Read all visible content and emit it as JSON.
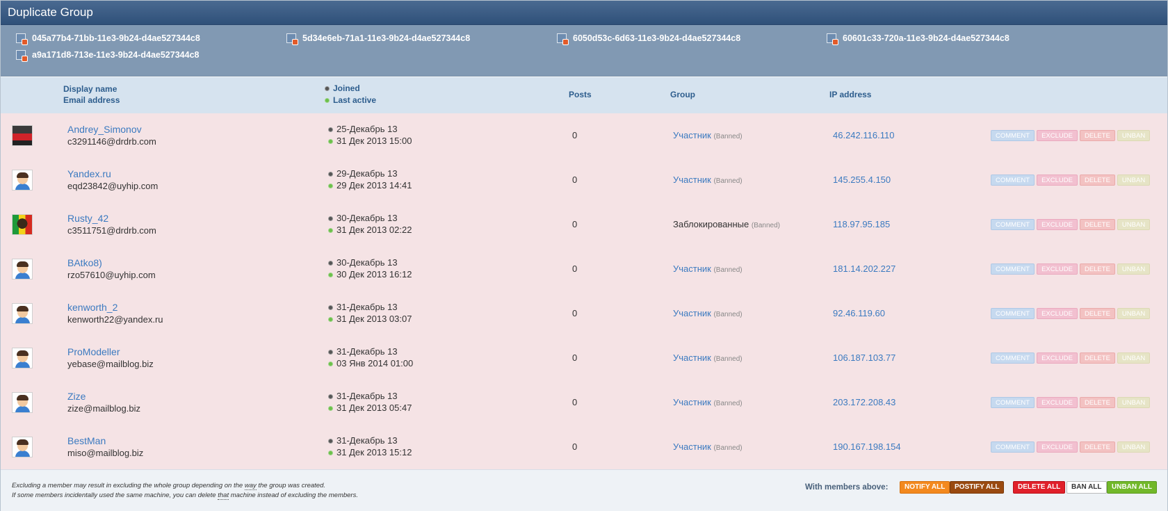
{
  "window": {
    "title": "Duplicate Group"
  },
  "machines": [
    "045a77b4-71bb-11e3-9b24-d4ae527344c8",
    "5d34e6eb-71a1-11e3-9b24-d4ae527344c8",
    "6050d53c-6d63-11e3-9b24-d4ae527344c8",
    "60601c33-720a-11e3-9b24-d4ae527344c8",
    "a9a171d8-713e-11e3-9b24-d4ae527344c8"
  ],
  "header": {
    "display_name": "Display name",
    "email": "Email address",
    "joined": "Joined",
    "last_active": "Last active",
    "posts": "Posts",
    "group": "Group",
    "ip": "IP address"
  },
  "banned_label": "(Banned)",
  "row_buttons": {
    "comment": "COMMENT",
    "exclude": "EXCLUDE",
    "delete": "DELETE",
    "unban": "UNBAN"
  },
  "members": [
    {
      "name": "Andrey_Simonov",
      "email": "c3291146@drdrb.com",
      "joined": "25-Декабрь 13",
      "last_active": "31 Дек 2013 15:00",
      "posts": "0",
      "group": "Участник",
      "ip": "46.242.116.110",
      "avatar": "car-avatar"
    },
    {
      "name": "Yandex.ru",
      "email": "eqd23842@uyhip.com",
      "joined": "29-Декабрь 13",
      "last_active": "29 Дек 2013 14:41",
      "posts": "0",
      "group": "Участник",
      "ip": "145.255.4.150",
      "avatar": "default-avatar"
    },
    {
      "name": "Rusty_42",
      "email": "c3511751@drdrb.com",
      "joined": "30-Декабрь 13",
      "last_active": "31 Дек 2013 02:22",
      "posts": "0",
      "group": "Заблокированные",
      "ip": "118.97.95.185",
      "avatar": "reggae-avatar"
    },
    {
      "name": "BAtko8)",
      "email": "rzo57610@uyhip.com",
      "joined": "30-Декабрь 13",
      "last_active": "30 Дек 2013 16:12",
      "posts": "0",
      "group": "Участник",
      "ip": "181.14.202.227",
      "avatar": "default-avatar"
    },
    {
      "name": "kenworth_2",
      "email": "kenworth22@yandex.ru",
      "joined": "31-Декабрь 13",
      "last_active": "31 Дек 2013 03:07",
      "posts": "0",
      "group": "Участник",
      "ip": "92.46.119.60",
      "avatar": "default-avatar"
    },
    {
      "name": "ProModeller",
      "email": "yebase@mailblog.biz",
      "joined": "31-Декабрь 13",
      "last_active": "03 Янв 2014 01:00",
      "posts": "0",
      "group": "Участник",
      "ip": "106.187.103.77",
      "avatar": "default-avatar"
    },
    {
      "name": "Zize",
      "email": "zize@mailblog.biz",
      "joined": "31-Декабрь 13",
      "last_active": "31 Дек 2013 05:47",
      "posts": "0",
      "group": "Участник",
      "ip": "203.172.208.43",
      "avatar": "default-avatar"
    },
    {
      "name": "BestMan",
      "email": "miso@mailblog.biz",
      "joined": "31-Декабрь 13",
      "last_active": "31 Дек 2013 15:12",
      "posts": "0",
      "group": "Участник",
      "ip": "190.167.198.154",
      "avatar": "default-avatar"
    }
  ],
  "footer": {
    "note1_pre": "Excluding a member may result in excluding the whole group depending on the ",
    "note1_u": "way",
    "note1_post": " the group was created.",
    "note2_pre": "If some members incidentally used the same machine, you can delete ",
    "note2_u": "that",
    "note2_post": " machine instead of excluding the members.",
    "with_members": "With members above:",
    "notify_all": "NOTIFY ALL",
    "postify_all": "POSTIFY ALL",
    "delete_all": "DELETE ALL",
    "ban_all": "BAN ALL",
    "unban_all": "UNBAN ALL"
  }
}
